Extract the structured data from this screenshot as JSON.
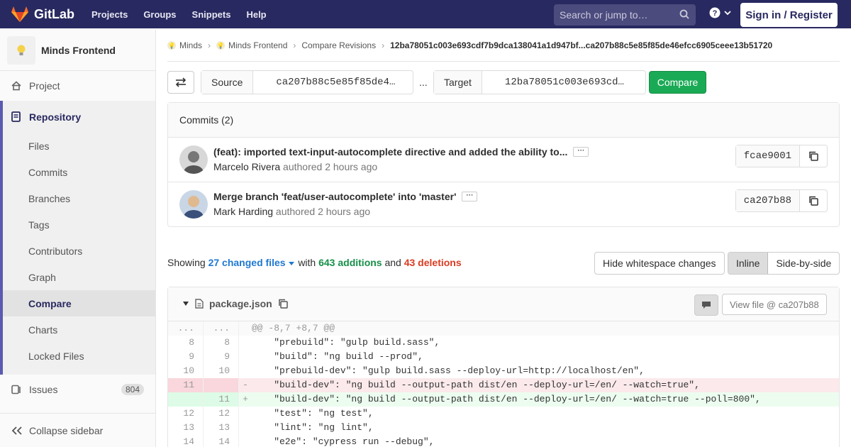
{
  "navbar": {
    "brand": "GitLab",
    "links": [
      "Projects",
      "Groups",
      "Snippets",
      "Help"
    ],
    "search_placeholder": "Search or jump to…",
    "signin_label": "Sign in / Register"
  },
  "sidebar": {
    "project_name": "Minds Frontend",
    "project_item": "Project",
    "repository_label": "Repository",
    "repository_items": [
      "Files",
      "Commits",
      "Branches",
      "Tags",
      "Contributors",
      "Graph",
      "Compare",
      "Charts",
      "Locked Files"
    ],
    "active_item": "Compare",
    "issues_label": "Issues",
    "issues_count": "804",
    "collapse_label": "Collapse sidebar"
  },
  "breadcrumb": {
    "items": [
      "Minds",
      "Minds Frontend",
      "Compare Revisions"
    ],
    "current": "12ba78051c003e693cdf7b9dca138041a1d947bf...ca207b88c5e85f85de46efcc6905ceee13b51720"
  },
  "compare": {
    "source_label": "Source",
    "source_value": "ca207b88c5e85f85de4…",
    "separator": "...",
    "target_label": "Target",
    "target_value": "12ba78051c003e693cd…",
    "compare_label": "Compare"
  },
  "commits": {
    "header": "Commits (2)",
    "items": [
      {
        "title": "(feat): imported text-input-autocomplete directive and added the ability to...",
        "author": "Marcelo Rivera",
        "authored": "authored",
        "time": "2 hours ago",
        "sha": "fcae9001"
      },
      {
        "title": "Merge branch 'feat/user-autocomplete' into 'master'",
        "author": "Mark Harding",
        "authored": "authored",
        "time": "2 hours ago",
        "sha": "ca207b88"
      }
    ]
  },
  "stats": {
    "showing": "Showing",
    "files": "27 changed files",
    "with": "with",
    "additions": "643 additions",
    "and": "and",
    "deletions": "43 deletions"
  },
  "view_options": {
    "whitespace_label": "Hide whitespace changes",
    "inline_label": "Inline",
    "side_by_side_label": "Side-by-side",
    "active": "Inline"
  },
  "file": {
    "name": "package.json",
    "view_file_label": "View file @ ca207b88",
    "lines": [
      {
        "type": "hunk",
        "old": "...",
        "new": "...",
        "sign": "",
        "text": "@@ -8,7 +8,7 @@"
      },
      {
        "type": "ctx",
        "old": "8",
        "new": "8",
        "sign": "",
        "text": "    \"prebuild\": \"gulp build.sass\","
      },
      {
        "type": "ctx",
        "old": "9",
        "new": "9",
        "sign": "",
        "text": "    \"build\": \"ng build --prod\","
      },
      {
        "type": "ctx",
        "old": "10",
        "new": "10",
        "sign": "",
        "text": "    \"prebuild-dev\": \"gulp build.sass --deploy-url=http://localhost/en\","
      },
      {
        "type": "del",
        "old": "11",
        "new": "",
        "sign": "-",
        "text": "    \"build-dev\": \"ng build --output-path dist/en --deploy-url=/en/ --watch=true\","
      },
      {
        "type": "add",
        "old": "",
        "new": "11",
        "sign": "+",
        "text": "    \"build-dev\": \"ng build --output-path dist/en --deploy-url=/en/ --watch=true --poll=800\","
      },
      {
        "type": "ctx",
        "old": "12",
        "new": "12",
        "sign": "",
        "text": "    \"test\": \"ng test\","
      },
      {
        "type": "ctx",
        "old": "13",
        "new": "13",
        "sign": "",
        "text": "    \"lint\": \"ng lint\","
      },
      {
        "type": "ctx",
        "old": "14",
        "new": "14",
        "sign": "",
        "text": "    \"e2e\": \"cypress run --debug\","
      }
    ]
  },
  "colors": {
    "navbar": "#292961",
    "accent": "#1aaa55",
    "additions": "#168f48",
    "deletions": "#db3b21",
    "link": "#1f78d1"
  }
}
